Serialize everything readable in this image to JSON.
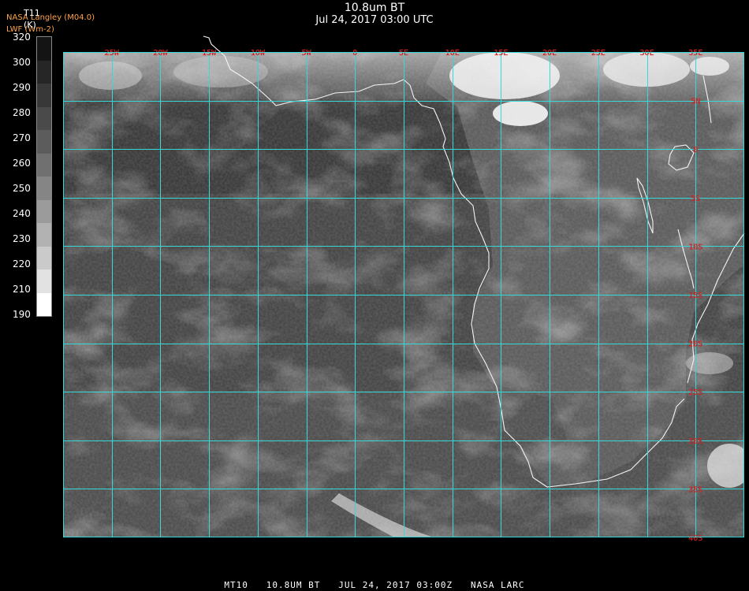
{
  "header": {
    "title": "10.8um BT",
    "subtitle": "Jul 24, 2017 03:00 UTC",
    "credit_line1": "NASA Langley (M04.0)",
    "credit_line2": "LWF (Wm-2)",
    "variable": "T11",
    "unit": "(K)"
  },
  "colorbar": {
    "labels": [
      "320",
      "300",
      "290",
      "280",
      "270",
      "260",
      "250",
      "240",
      "230",
      "220",
      "210",
      "190"
    ],
    "colors": [
      "#141414",
      "#262626",
      "#383838",
      "#4a4a4a",
      "#5c5c5c",
      "#707070",
      "#858585",
      "#9b9b9b",
      "#b2b2b2",
      "#cacaca",
      "#e2e2e2",
      "#ffffff"
    ]
  },
  "map": {
    "longitude_labels": [
      "25W",
      "20W",
      "15W",
      "10W",
      "5W",
      "0",
      "5E",
      "10E",
      "15E",
      "20E",
      "25E",
      "30E",
      "35E"
    ],
    "latitude_labels": [
      "5N",
      "0",
      "5S",
      "10S",
      "15S",
      "20S",
      "25S",
      "30S",
      "35S",
      "40S"
    ],
    "lon_range": [
      -30,
      40
    ],
    "lat_range": [
      10,
      -40
    ],
    "grid_color": "#37d8d8",
    "label_color": "#b01010",
    "coast_color": "#f4f4f4"
  },
  "footer": {
    "text": "MT10   10.8UM BT   JUL 24, 2017 03:00Z   NASA LARC"
  }
}
